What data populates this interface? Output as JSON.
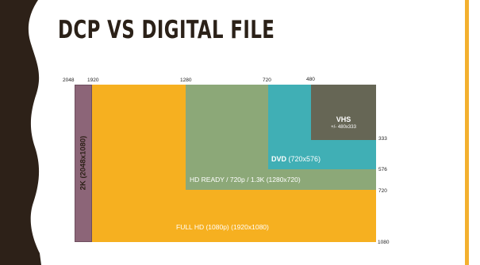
{
  "slide": {
    "title": "DCP VS DIGITAL FILE"
  },
  "colors": {
    "dark_band": "#2d2118",
    "accent_yellow": "#f6b020",
    "purple": "#8c6578",
    "green": "#8ca878",
    "teal": "#40afb5",
    "gray": "#666655"
  },
  "diagram": {
    "top_ticks": [
      "2048",
      "1920",
      "1280",
      "720",
      "480"
    ],
    "right_ticks": [
      "333",
      "576",
      "720",
      "1080"
    ],
    "boxes": {
      "k2": {
        "label": "2K (2048x1080)"
      },
      "fullhd": {
        "label": "FULL HD (1080p) (1920x1080)"
      },
      "hdready": {
        "label": "HD READY / 720p / 1.3K (1280x720)"
      },
      "dvd": {
        "label_bold": "DVD",
        "label_rest": "(720x576)"
      },
      "vhs": {
        "label": "VHS",
        "sub": "+/- 480x333"
      }
    }
  }
}
